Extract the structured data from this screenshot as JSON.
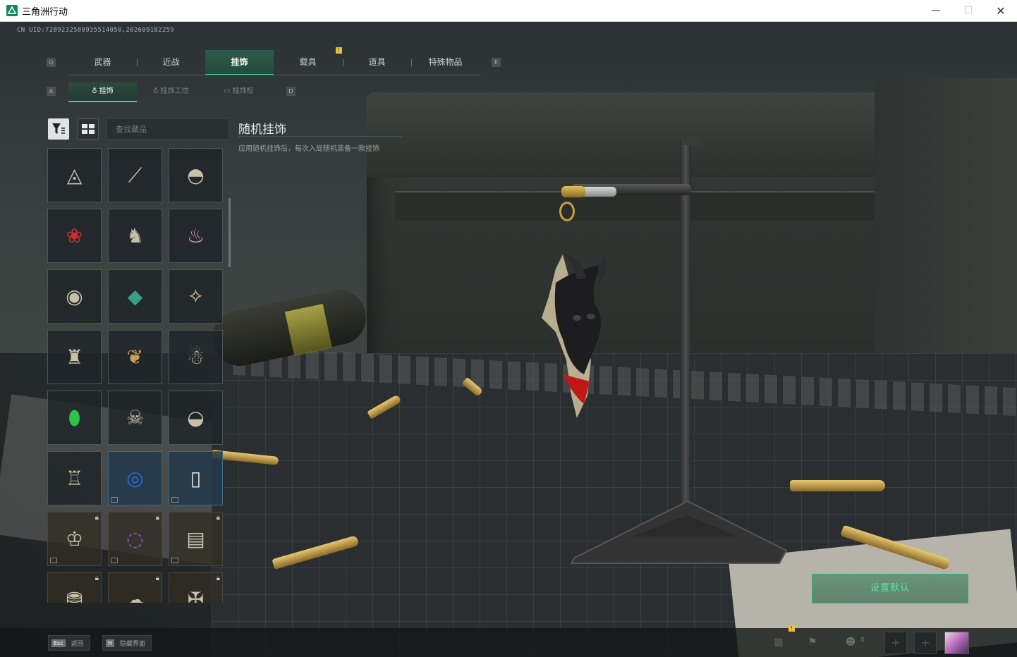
{
  "window": {
    "title": "三角洲行动",
    "controls": {
      "minimize": "—",
      "maximize": "☐",
      "close": "✕"
    }
  },
  "uid_text": "CN UID:7289232580935514050,202609182259",
  "main_tabs": [
    {
      "label": "武器",
      "active": false
    },
    {
      "label": "近战",
      "active": false
    },
    {
      "label": "挂饰",
      "active": true
    },
    {
      "label": "载具",
      "active": false
    },
    {
      "label": "道具",
      "active": false
    },
    {
      "label": "特殊物品",
      "active": false
    }
  ],
  "main_tabs_prev_key": "Q",
  "main_tabs_next_key": "E",
  "vehicle_badge": "!",
  "sub_tabs": [
    {
      "label": "挂饰",
      "active": true,
      "icon": "pendant-icon"
    },
    {
      "label": "挂饰工坊",
      "active": false,
      "icon": "pendant-icon"
    },
    {
      "label": "挂饰柜",
      "active": false,
      "icon": "cabinet-icon"
    }
  ],
  "sub_tabs_prev_key": "A",
  "sub_tabs_next_key": "D",
  "search": {
    "placeholder": "查找藏品",
    "value": ""
  },
  "detail": {
    "title": "随机挂饰",
    "description": "应用随机挂饰后，每次入局随机装备一款挂饰"
  },
  "items": [
    {
      "icon": "pyramid-eye-charm-icon",
      "state": "owned"
    },
    {
      "icon": "knife-charm-icon",
      "state": "owned"
    },
    {
      "icon": "hat-charm-icon",
      "state": "owned"
    },
    {
      "icon": "rose-charm-icon",
      "state": "owned"
    },
    {
      "icon": "figurine-charm-icon",
      "state": "owned"
    },
    {
      "icon": "cupcake-charm-icon",
      "state": "owned"
    },
    {
      "icon": "medal-charm-icon",
      "state": "owned"
    },
    {
      "icon": "gem-charm-icon",
      "state": "owned"
    },
    {
      "icon": "feather-charm-icon",
      "state": "owned"
    },
    {
      "icon": "chess-rook-charm-icon",
      "state": "owned"
    },
    {
      "icon": "antlers-charm-icon",
      "state": "owned"
    },
    {
      "icon": "cat-charm-icon",
      "state": "owned"
    },
    {
      "icon": "green-egg-charm-icon",
      "state": "owned"
    },
    {
      "icon": "skull-ball-charm-icon",
      "state": "owned"
    },
    {
      "icon": "shell-charm-icon",
      "state": "owned"
    },
    {
      "icon": "robot-charm-icon",
      "state": "owned"
    },
    {
      "icon": "blue-orb-charm-icon",
      "state": "premium"
    },
    {
      "icon": "card-charm-icon",
      "state": "premium"
    },
    {
      "icon": "trophy-charm-icon",
      "state": "locked"
    },
    {
      "icon": "purple-ring-charm-icon",
      "state": "locked"
    },
    {
      "icon": "tarot-charm-icon",
      "state": "locked"
    },
    {
      "icon": "gold-pile-charm-icon",
      "state": "locked"
    },
    {
      "icon": "cloud-charm-icon",
      "state": "locked"
    },
    {
      "icon": "bones-charm-icon",
      "state": "locked"
    }
  ],
  "set_default_label": "设置默认",
  "footer": {
    "back_key": "Esc",
    "back_label": "返回",
    "hide_key": "H",
    "hide_label": "隐藏界面",
    "friend_count": "8",
    "alert_badge": "!"
  },
  "colors": {
    "accent": "#3bd08c",
    "tab_active_bg": "#2e5a48",
    "badge": "#e8c23a"
  }
}
